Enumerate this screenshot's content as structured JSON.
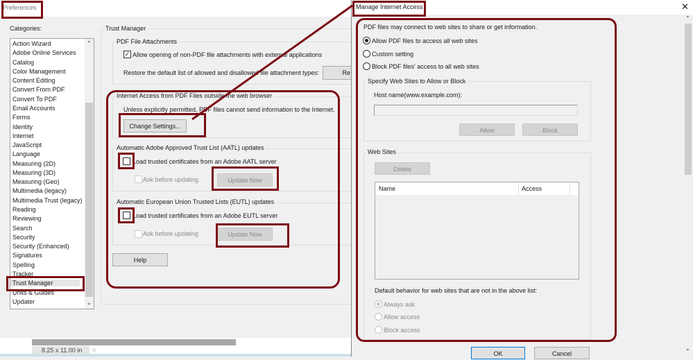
{
  "preferences": {
    "title": "Preferences",
    "categories_label": "Categories:",
    "categories": [
      "Action Wizard",
      "Adobe Online Services",
      "Catalog",
      "Color Management",
      "Content Editing",
      "Convert From PDF",
      "Convert To PDF",
      "Email Accounts",
      "Forms",
      "Identity",
      "Internet",
      "JavaScript",
      "Language",
      "Measuring (2D)",
      "Measuring (3D)",
      "Measuring (Geo)",
      "Multimedia (legacy)",
      "Multimedia Trust (legacy)",
      "Reading",
      "Reviewing",
      "Search",
      "Security",
      "Security (Enhanced)",
      "Signatures",
      "Spelling",
      "Tracker",
      "Trust Manager",
      "Units & Guides",
      "Updater"
    ],
    "selected_category": "Trust Manager",
    "panel_title": "Trust Manager",
    "attachments": {
      "title": "PDF File Attachments",
      "allow_label": "Allow opening of non-PDF file attachments with external applications",
      "allow_checked": true,
      "restore_label": "Restore the default list of allowed and disallowed file attachment types:",
      "restore_button": "Re"
    },
    "internet": {
      "title": "Internet Access from PDF Files outside the web browser",
      "note": "Unless explicitly permitted, PDF files cannot send information to the Internet.",
      "change_button": "Change Settings..."
    },
    "aatl": {
      "title": "Automatic Adobe Approved Trust List (AATL) updates",
      "load_label": "Load trusted certificates from an Adobe AATL server",
      "ask_label": "Ask before updating",
      "update_button": "Update Now"
    },
    "eutl": {
      "title": "Automatic European Union Trusted Lists (EUTL) updates",
      "load_label": "Load trusted certificates from an Adobe EUTL server",
      "ask_label": "Ask before updating",
      "update_button": "Update Now"
    },
    "help_button": "Help",
    "page_size": "8.25 x 11.00 in"
  },
  "manage": {
    "title": "Manage Internet Access",
    "intro": "PDF files may connect to web sites to share or get information.",
    "options": [
      "Allow PDF files to access all web sites",
      "Custom setting",
      "Block PDF files' access to all web sites"
    ],
    "selected_option": 0,
    "specify": {
      "title": "Specify Web Sites to Allow or Block",
      "host_label": "Host name(www.example.com):",
      "host_value": "",
      "allow_button": "Allow",
      "block_button": "Block"
    },
    "websites": {
      "title": "Web Sites",
      "delete_button": "Delete",
      "columns": [
        "Name",
        "Access"
      ],
      "rows": []
    },
    "default_label": "Default behavior for web sites that are not in the above list:",
    "default_options": [
      "Always ask",
      "Allow access",
      "Block access"
    ],
    "ok_button": "OK",
    "cancel_button": "Cancel"
  },
  "colors": {
    "annotation": "#7c0a14",
    "dialog_bg": "#f0f0f0"
  }
}
